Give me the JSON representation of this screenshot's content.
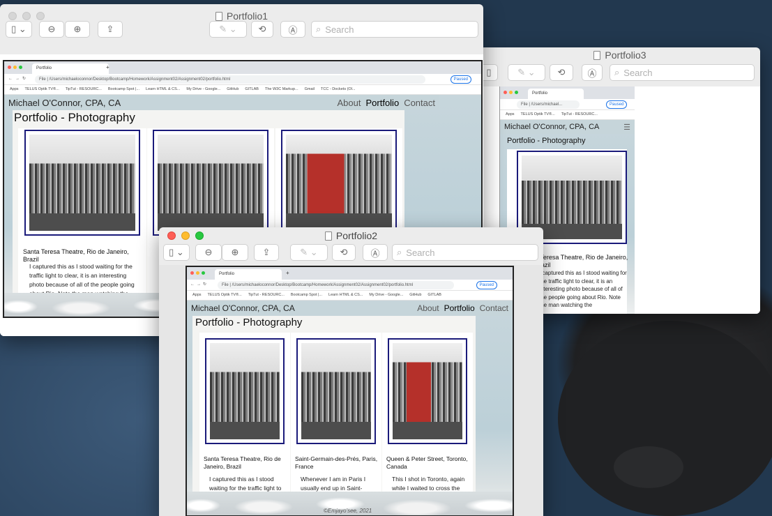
{
  "windows": {
    "w1": {
      "title": "Portfolio1",
      "search_placeholder": "Search"
    },
    "w2": {
      "title": "Portfolio2",
      "search_placeholder": "Search"
    },
    "w3": {
      "title": "Portfolio3",
      "search_placeholder": "Search"
    }
  },
  "browser": {
    "tab_title": "Portfolio",
    "new_tab": "+",
    "url_scheme": "File",
    "url": "/Users/michaeloconnor/Desktop/Bootcamp/Homework/Assignment02/Assignment02/portfolio.html",
    "url_short": "/Users/michael...",
    "paused": "Paused",
    "bookmarks": [
      "Apps",
      "TELUS Optik TV®...",
      "TipTut - RESOURC...",
      "Bootcamp Spot |...",
      "Learn HTML & CS...",
      "My Drive - Google...",
      "GitHub",
      "GITLAB",
      "The W3C Markup...",
      "Gmail",
      "TCC - Dockets (Ol..."
    ]
  },
  "site": {
    "brand": "Michael O'Connor, CPA, CA",
    "nav": [
      "About",
      "Portfolio",
      "Contact"
    ],
    "active_nav": "Portfolio",
    "page_title": "Portfolio - Photography",
    "footer": "©Emjayo'see, 2021",
    "cards": [
      {
        "caption": "Santa Teresa Theatre, Rio de Janeiro, Brazil",
        "text": "I captured this as I stood waiting for the traffic light to clear, it is an interesting photo because of all of the people going about Rio. Note the man watching the"
      },
      {
        "caption": "Saint-Germain-des-Prés, Paris, France",
        "text": "Whenever I am in Paris I usually end up in Saint-Germain-des-Prés. I shot"
      },
      {
        "caption": "Queen & Peter Street, Toronto, Canada",
        "text": "This I shot in Toronto, again while I waited to cross the street on a"
      }
    ]
  },
  "colors": {
    "photo_border": "#1a1a7a",
    "nav_bg": "#c6d5da",
    "paused": "#1a73e8"
  }
}
